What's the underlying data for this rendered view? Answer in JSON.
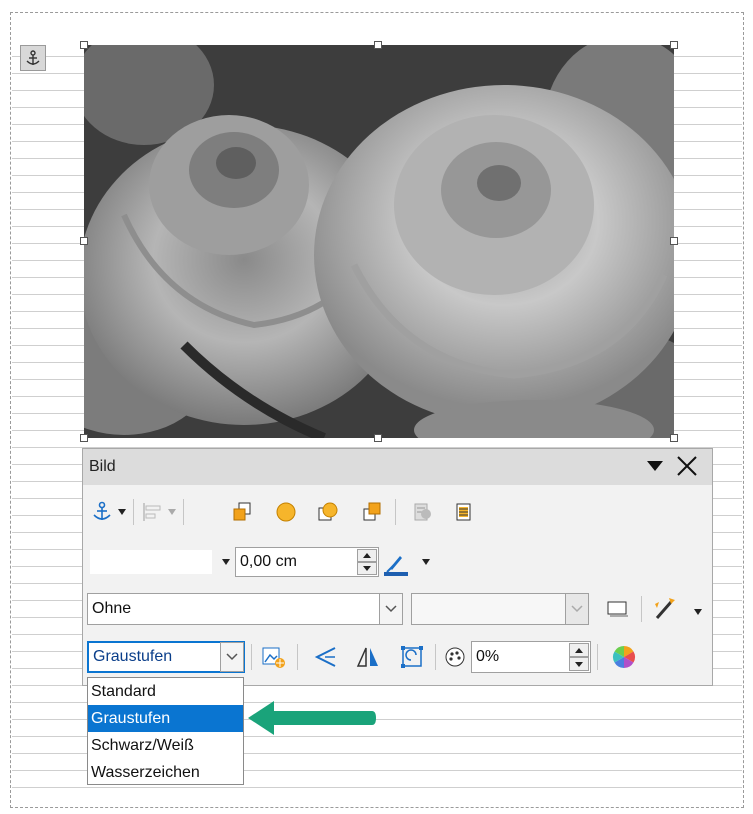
{
  "toolbar": {
    "title": "Bild",
    "position_value": "0,00 cm",
    "wrap_select": "Ohne",
    "graphics_mode": "Graustufen",
    "transparency": "0%"
  },
  "graphics_mode_options": [
    {
      "label": "Standard",
      "selected": false
    },
    {
      "label": "Graustufen",
      "selected": true
    },
    {
      "label": "Schwarz/Weiß",
      "selected": false
    },
    {
      "label": "Wasserzeichen",
      "selected": false
    }
  ],
  "image": {
    "description": ""
  },
  "colors": {
    "selection_blue": "#0a75d1",
    "arrow_green": "#1aa37a",
    "icon_orange": "#f2a21b",
    "icon_blue": "#1b6fc7"
  },
  "icons": [
    "anchor-icon",
    "align-icon",
    "bring-forward-icon",
    "wrap-on-icon",
    "wrap-off-icon",
    "send-backward-icon",
    "to-background-icon",
    "to-foreground-icon",
    "line-color-icon",
    "border-icon",
    "image-map-icon",
    "crop-icon",
    "flip-vertical-icon",
    "flip-horizontal-icon",
    "rotate-icon",
    "color-palette-icon",
    "color-wheel-icon",
    "close-icon",
    "menu-arrow-icon"
  ]
}
